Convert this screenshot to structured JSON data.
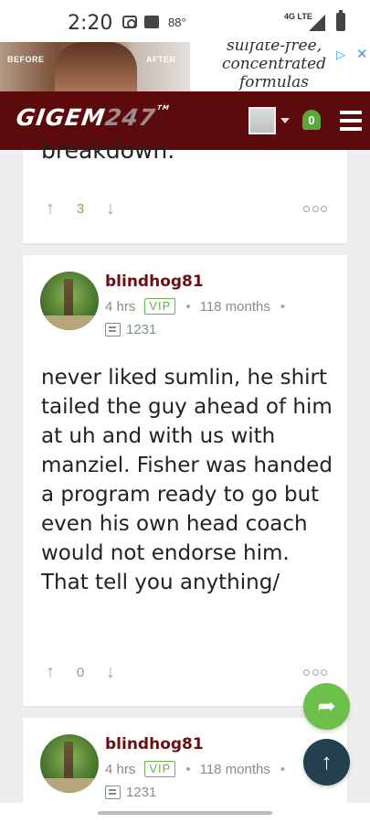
{
  "status_bar": {
    "time": "2:20",
    "temperature": "88°",
    "network": "4G LTE",
    "icons": [
      "camera-icon",
      "image-icon",
      "signal-icon",
      "battery-icon"
    ]
  },
  "ad": {
    "before_label": "BEFORE",
    "after_label": "AFTER",
    "text": "sulfate-free, concentrated formulas",
    "close_symbol": "✕",
    "choice_symbol": "▷"
  },
  "header": {
    "logo_main": "GIGEM",
    "logo_num": "247",
    "logo_tm": "TM",
    "notification_count": "0",
    "colors": {
      "background": "#5c0a0c",
      "bell": "#5aa83a"
    }
  },
  "top_card": {
    "text_fragment": "breakdown.",
    "score": "3"
  },
  "posts": [
    {
      "username": "blindhog81",
      "time": "4 hrs",
      "badge": "VIP",
      "tenure": "118 months",
      "post_count": "1231",
      "body": "never liked sumlin, he shirt tailed the guy ahead of him at uh and with us with manziel. Fisher was handed a program ready to go but even his own head coach would not endorse him. That tell you anything/",
      "score": "0"
    },
    {
      "username": "blindhog81",
      "time": "4 hrs",
      "badge": "VIP",
      "tenure": "118 months",
      "post_count": "1231"
    }
  ],
  "symbols": {
    "up_arrow": "↑",
    "down_arrow": "↓",
    "dot": "•",
    "reply": "➦",
    "scroll_top": "↑"
  },
  "colors": {
    "username": "#6a1012",
    "accent_green": "#6ab04c",
    "scroll_top_button": "#23404f",
    "reply_button": "#6cc04a"
  }
}
